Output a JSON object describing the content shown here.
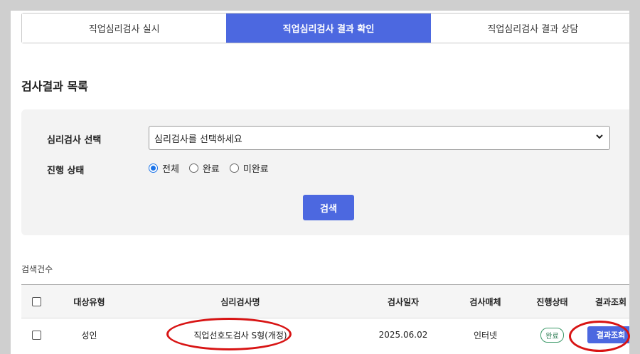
{
  "tabs": [
    {
      "label": "직업심리검사 실시",
      "active": false
    },
    {
      "label": "직업심리검사 결과 확인",
      "active": true
    },
    {
      "label": "직업심리검사 결과 상담",
      "active": false
    }
  ],
  "section_title": "검사결과 목록",
  "filter": {
    "test_select_label": "심리검사 선택",
    "test_select_value": "심리검사를 선택하세요",
    "status_label": "진행 상태",
    "status_options": [
      "전체",
      "완료",
      "미완료"
    ],
    "status_selected": "전체",
    "search_button": "검색"
  },
  "count_label": "검색건수",
  "table": {
    "headers": [
      "대상유형",
      "심리검사명",
      "검사일자",
      "검사매체",
      "진행상태",
      "결과조회"
    ],
    "rows": [
      {
        "target_type": "성인",
        "test_name": "직업선호도검사 S형(개정)",
        "test_date": "2025.06.02",
        "medium": "인터넷",
        "status": "완료",
        "result_button": "결과조회"
      }
    ]
  },
  "colors": {
    "accent": "#4c68e0",
    "annotation_red": "#d81414",
    "status_green": "#3e9a6a"
  },
  "icons": {
    "select_chevron": "chevron-down-icon"
  }
}
